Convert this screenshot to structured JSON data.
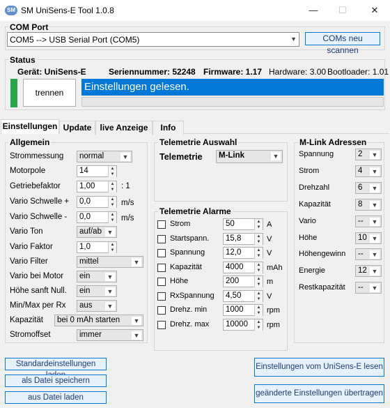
{
  "window": {
    "icon_text": "SM",
    "title": "SM UniSens-E Tool 1.0.8",
    "minimize": "—",
    "maximize": "☐",
    "close": "✕"
  },
  "com": {
    "title": "COM Port",
    "port": "COM5 --> USB Serial Port (COM5)",
    "rescan": "COMs neu scannen"
  },
  "status": {
    "title": "Status",
    "geraet": "Gerät: UniSens-E",
    "serial": "Seriennummer: 52248",
    "firmware": "Firmware: 1.17",
    "hardware": "Hardware: 3.00",
    "bootloader": "Bootloader: 1.01",
    "disconnect": "trennen",
    "message": "Einstellungen gelesen."
  },
  "tabs": [
    "Einstellungen",
    "Update",
    "live Anzeige",
    "Info"
  ],
  "allgemein": {
    "title": "Allgemein",
    "strommessung": {
      "label": "Strommessung",
      "value": "normal"
    },
    "motorpole": {
      "label": "Motorpole",
      "value": "14"
    },
    "getriebe": {
      "label": "Getriebefaktor",
      "value": "1,00",
      "suffix": ": 1"
    },
    "vario_plus": {
      "label": "Vario Schwelle +",
      "value": "0,0",
      "unit": "m/s"
    },
    "vario_minus": {
      "label": "Vario Schwelle -",
      "value": "0,0",
      "unit": "m/s"
    },
    "vario_ton": {
      "label": "Vario Ton",
      "value": "auf/ab"
    },
    "vario_faktor": {
      "label": "Vario Faktor",
      "value": "1,0"
    },
    "vario_filter": {
      "label": "Vario Filter",
      "value": "mittel"
    },
    "vario_motor": {
      "label": "Vario bei Motor",
      "value": "ein"
    },
    "hoehe_null": {
      "label": "Höhe sanft Null.",
      "value": "ein"
    },
    "minmax": {
      "label": "Min/Max per Rx",
      "value": "aus"
    },
    "kapazitaet": {
      "label": "Kapazität",
      "value": "bei 0 mAh starten"
    },
    "stromoffset": {
      "label": "Stromoffset",
      "value": "immer"
    }
  },
  "telemetrie": {
    "title": "Telemetrie Auswahl",
    "label": "Telemetrie",
    "value": "M-Link"
  },
  "alarme": {
    "title": "Telemetrie Alarme",
    "items": [
      {
        "label": "Strom",
        "value": "50",
        "unit": "A"
      },
      {
        "label": "Startspann.",
        "value": "15,8",
        "unit": "V"
      },
      {
        "label": "Spannung",
        "value": "12,0",
        "unit": "V"
      },
      {
        "label": "Kapazität",
        "value": "4000",
        "unit": "mAh"
      },
      {
        "label": "Höhe",
        "value": "200",
        "unit": "m"
      },
      {
        "label": "RxSpannung",
        "value": "4,50",
        "unit": "V"
      },
      {
        "label": "Drehz. min",
        "value": "1000",
        "unit": "rpm"
      },
      {
        "label": "Drehz. max",
        "value": "10000",
        "unit": "rpm"
      }
    ]
  },
  "mlink": {
    "title": "M-Link Adressen",
    "items": [
      {
        "label": "Spannung",
        "value": "2"
      },
      {
        "label": "Strom",
        "value": "4"
      },
      {
        "label": "Drehzahl",
        "value": "6"
      },
      {
        "label": "Kapazität",
        "value": "8"
      },
      {
        "label": "Vario",
        "value": "--"
      },
      {
        "label": "Höhe",
        "value": "10"
      },
      {
        "label": "Höhengewinn",
        "value": "--"
      },
      {
        "label": "Energie",
        "value": "12"
      },
      {
        "label": "Restkapazität",
        "value": "--"
      }
    ]
  },
  "buttons": {
    "defaults": "Standardeinstellungen laden",
    "save_file": "als Datei speichern",
    "load_file": "aus Datei laden",
    "read": "Einstellungen vom UniSens-E lesen",
    "write": "geänderte Einstellungen übertragen"
  },
  "colors": {
    "status_message_bg": "#0078d7",
    "connected_indicator": "#2aa54a"
  }
}
